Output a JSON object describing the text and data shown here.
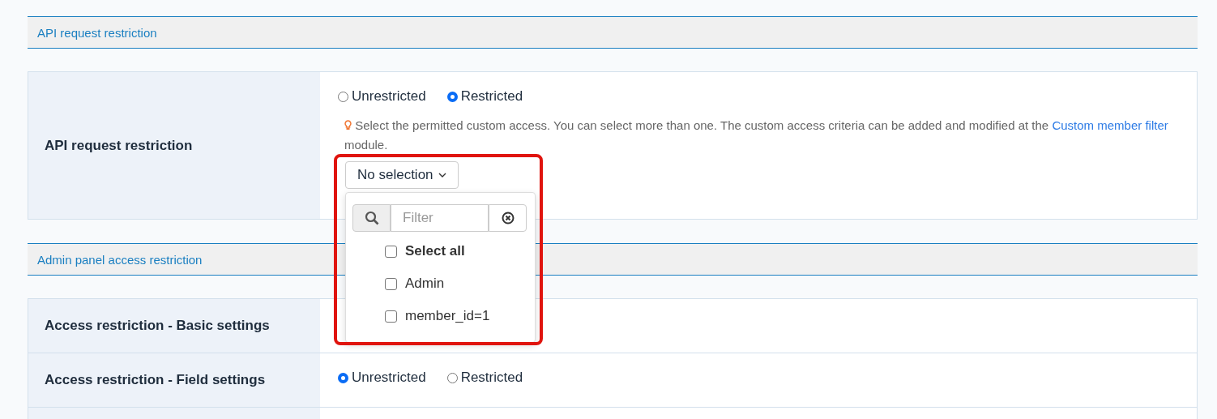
{
  "sections": [
    {
      "title": "API request restriction",
      "rows": [
        {
          "label": "API request restriction",
          "options": [
            {
              "label": "Unrestricted",
              "selected": false
            },
            {
              "label": "Restricted",
              "selected": true
            }
          ],
          "hint": {
            "text": "Select the permitted custom access. You can select more than one. The custom access criteria can be added and modified at the",
            "link": "Custom member filter",
            "suffix": "module."
          },
          "multiselect": {
            "button": "No selection",
            "filter_placeholder": "Filter",
            "items": [
              {
                "label": "Select all",
                "kind": "all",
                "checked": false
              },
              {
                "label": "Admin",
                "kind": "item",
                "checked": false
              },
              {
                "label": "member_id=1",
                "kind": "item",
                "checked": false
              }
            ]
          }
        }
      ]
    },
    {
      "title": "Admin panel access restriction",
      "rows": [
        {
          "label": "Access restriction - Basic settings"
        },
        {
          "label": "Access restriction - Field settings",
          "options": [
            {
              "label": "Unrestricted",
              "selected": true
            },
            {
              "label": "Restricted",
              "selected": false
            }
          ]
        },
        {
          "kind": "blank"
        }
      ]
    }
  ]
}
